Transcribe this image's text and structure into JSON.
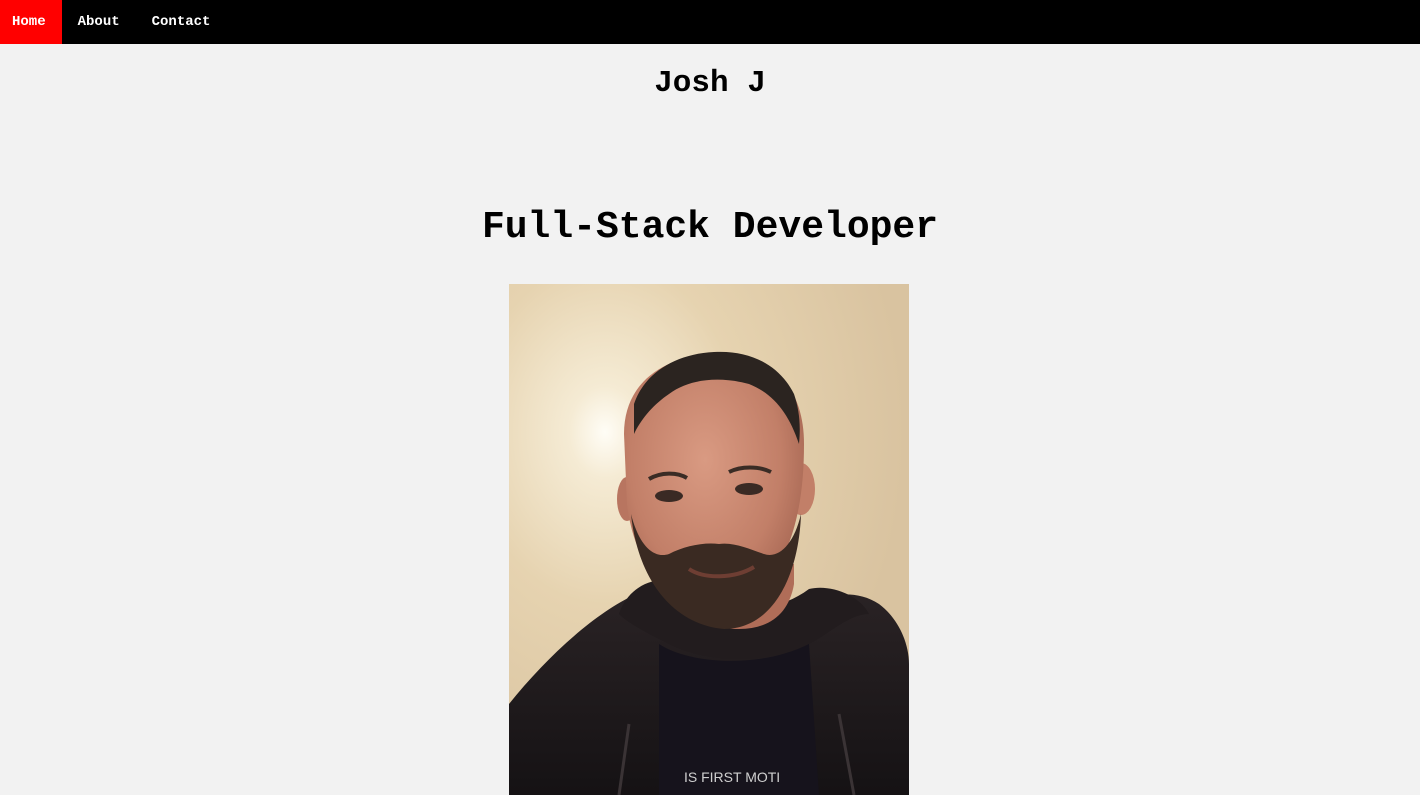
{
  "nav": {
    "items": [
      {
        "label": "Home",
        "active": true
      },
      {
        "label": "About",
        "active": false
      },
      {
        "label": "Contact",
        "active": false
      }
    ],
    "active_color": "#ff0000",
    "bar_color": "#000000"
  },
  "header": {
    "name": "Josh J"
  },
  "hero": {
    "tagline": "Full-Stack Developer",
    "photo_alt": "Josh J"
  },
  "background_color": "#f2f2f2"
}
